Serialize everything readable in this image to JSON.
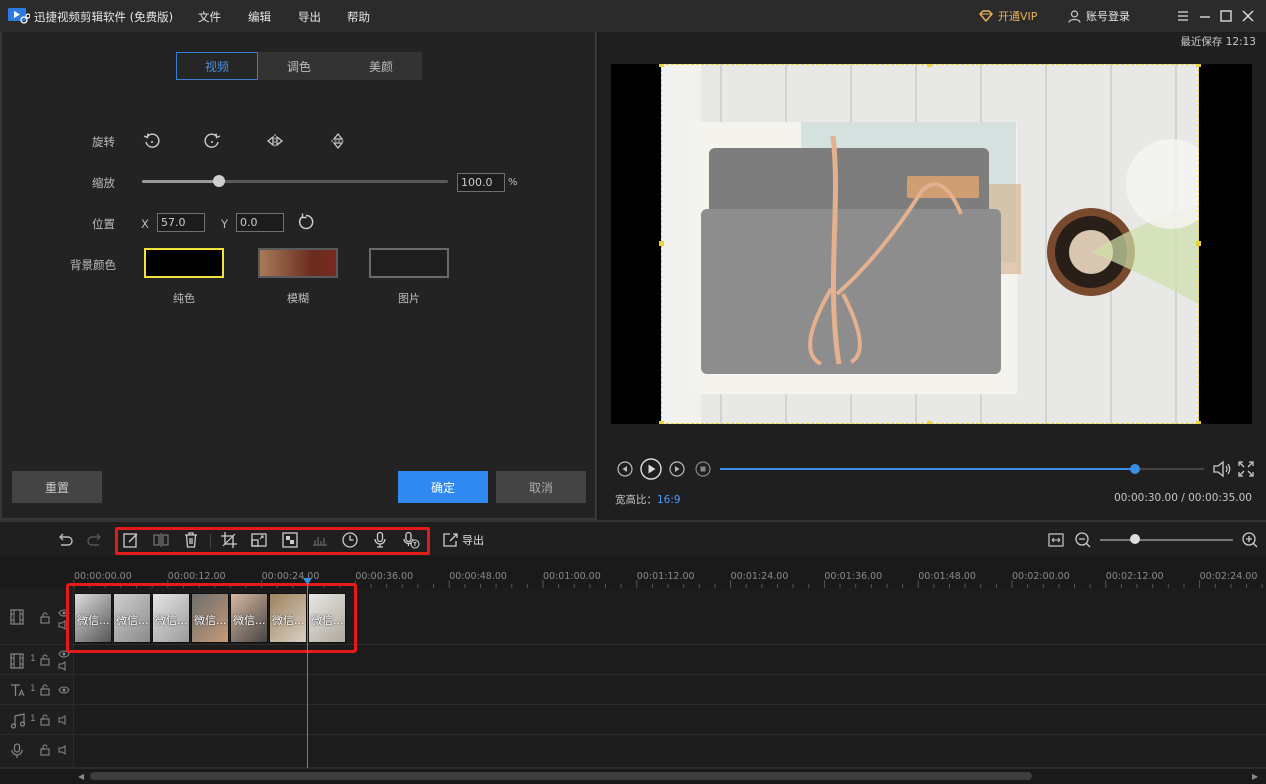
{
  "app": {
    "title": "迅捷视频剪辑软件 (免费版)"
  },
  "menu": [
    "文件",
    "编辑",
    "导出",
    "帮助"
  ],
  "header": {
    "vip_label": "开通VIP",
    "login_label": "账号登录"
  },
  "editor": {
    "tabs": [
      {
        "label": "视频",
        "active": true
      },
      {
        "label": "调色",
        "active": false
      },
      {
        "label": "美颜",
        "active": false
      }
    ],
    "rotate_label": "旋转",
    "scale_label": "缩放",
    "scale_value": "100.0",
    "scale_unit": "%",
    "scale_level": 0.25,
    "position_label": "位置",
    "x_label": "X",
    "x_value": "57.0",
    "y_label": "Y",
    "y_value": "0.0",
    "bg_label": "背景颜色",
    "bg_options": [
      "纯色",
      "模糊",
      "图片"
    ],
    "reset_label": "重置",
    "confirm_label": "确定",
    "cancel_label": "取消"
  },
  "preview": {
    "last_saved": "最近保存 12:13",
    "aspect_label": "宽高比：",
    "aspect_value": "16:9",
    "timecode": "00:00:30.00 / 00:00:35.00",
    "progress": 0.857
  },
  "toolbar": {
    "export_label": "导出"
  },
  "timeline": {
    "ticks": [
      "00:00:00.00",
      "00:00:12.00",
      "00:00:24.00",
      "00:00:36.00",
      "00:00:48.00",
      "00:01:00.00",
      "00:01:12.00",
      "00:01:24.00",
      "00:01:36.00",
      "00:01:48.00",
      "00:02:00.00",
      "00:02:12.00",
      "00:02:24.00"
    ],
    "clips": [
      "微信...",
      "微信...",
      "微信...",
      "微信...",
      "微信...",
      "微信...",
      "微信..."
    ],
    "lane_counts": [
      "1",
      "1",
      "1"
    ]
  },
  "colors": {
    "accent": "#3a8ee6",
    "highlight": "#e31b1b",
    "vip": "#e8b25a"
  }
}
